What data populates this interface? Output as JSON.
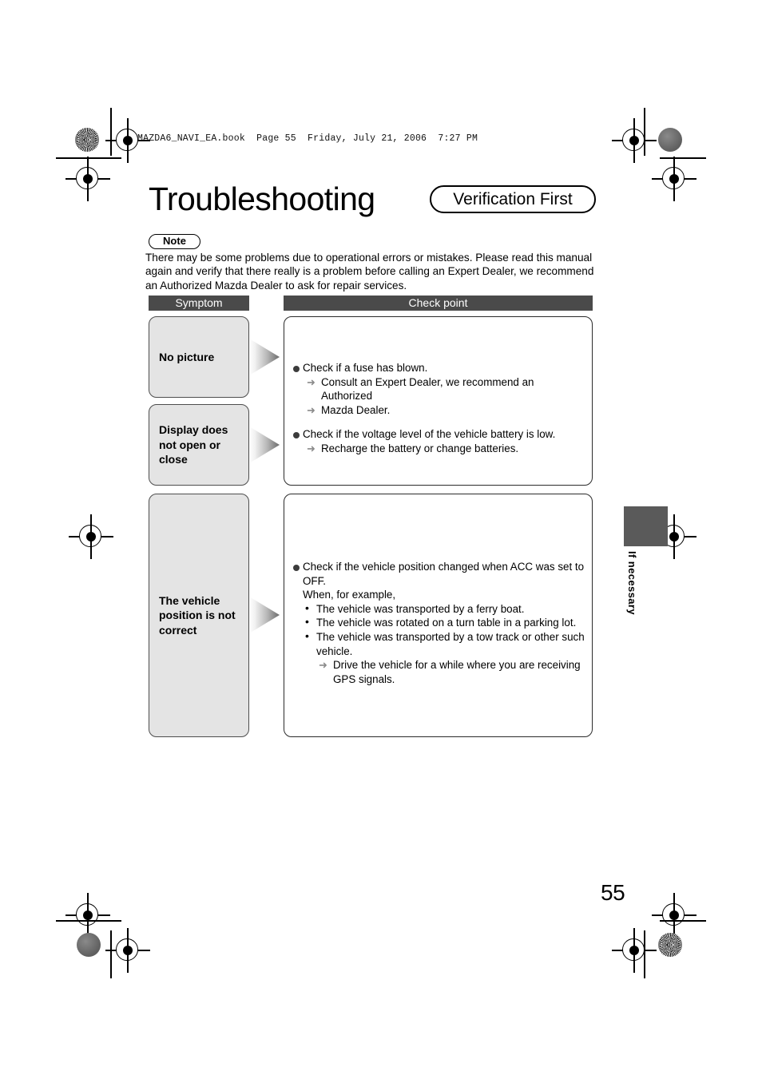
{
  "file_header": "MAZDA6_NAVI_EA.book  Page 55  Friday, July 21, 2006  7:27 PM",
  "title": {
    "heading": "Troubleshooting",
    "badge": "Verification First"
  },
  "note": {
    "label": "Note",
    "text": "There may be some problems due to operational errors or mistakes. Please read this manual again and verify that there really is a problem before calling an Expert Dealer, we recommend an Authorized Mazda Dealer to ask for repair services."
  },
  "table": {
    "headers": {
      "symptom": "Symptom",
      "check_point": "Check point"
    },
    "symptoms": [
      {
        "label": "No picture"
      },
      {
        "label": "Display does not open or close"
      },
      {
        "label": "The vehicle position is not correct"
      }
    ],
    "check_groups": [
      {
        "lines": [
          {
            "style": "bullet",
            "text": "Check if a fuse has blown."
          },
          {
            "style": "arrow",
            "text": "Consult an Expert Dealer, we recommend an Authorized"
          },
          {
            "style": "cont",
            "text": "Mazda Dealer."
          },
          {
            "style": "gap",
            "text": ""
          },
          {
            "style": "bullet",
            "text": "Check if the voltage level of the vehicle battery is low."
          },
          {
            "style": "arrow",
            "text": "Recharge the battery or change batteries."
          }
        ]
      },
      {
        "lines": [
          {
            "style": "bullet",
            "text": "Check if the vehicle position changed when ACC was set to"
          },
          {
            "style": "plain",
            "text": "OFF."
          },
          {
            "style": "plain",
            "text": "When, for example,"
          },
          {
            "style": "dot",
            "text": "The vehicle was transported by a ferry boat."
          },
          {
            "style": "dot",
            "text": "The vehicle was rotated on a turn table in a parking lot."
          },
          {
            "style": "dot",
            "text": "The vehicle was transported by a tow track or other such"
          },
          {
            "style": "dotcont",
            "text": "vehicle."
          },
          {
            "style": "arrow2",
            "text": "Drive the vehicle for a while where you are receiving"
          },
          {
            "style": "arrow2cont",
            "text": "GPS signals."
          }
        ]
      }
    ]
  },
  "side_tab": {
    "label": "If necessary"
  },
  "page_number": "55",
  "colors": {
    "header_bar": "#4a4a4a",
    "symptom_fill": "#e4e4e4",
    "side_tab": "#5a5a5a"
  }
}
